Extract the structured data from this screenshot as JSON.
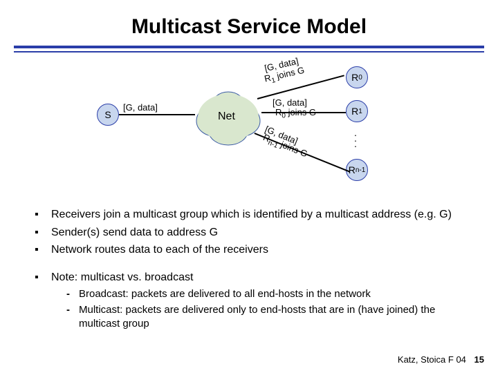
{
  "title": "Multicast Service Model",
  "diagram": {
    "source_label": "S",
    "net_label": "Net",
    "edge_s_net": "[G, data]",
    "r0_label_base": "R",
    "r0_label_sub": "0",
    "r1_label_base": "R",
    "r1_label_sub": "1",
    "rn_label_base": "R",
    "rn_label_sub": "n-1",
    "edge_r0_a": "[G, data]",
    "edge_r0_b_pre": "R",
    "edge_r0_b_sub": "1",
    "edge_r0_b_post": " joins G",
    "edge_r1_a": "[G, data]",
    "edge_r1_b_pre": "R",
    "edge_r1_b_sub": "0",
    "edge_r1_b_post": " joins G",
    "edge_rn_a": "[G, data]",
    "edge_rn_b_pre": "R",
    "edge_rn_b_sub": "n-1",
    "edge_rn_b_post": " joins G"
  },
  "bullets": {
    "b1": "Receivers join a multicast group which is identified by a multicast address (e.g. G)",
    "b2": "Sender(s) send data to address G",
    "b3": "Network routes data to each of the receivers",
    "b4": "Note: multicast vs. broadcast",
    "sub1": "Broadcast: packets are delivered to all end-hosts in the network",
    "sub2": "Multicast: packets are delivered only to end-hosts that are in (have joined) the multicast group"
  },
  "footer": {
    "text": "Katz, Stoica F 04",
    "page": "15"
  }
}
